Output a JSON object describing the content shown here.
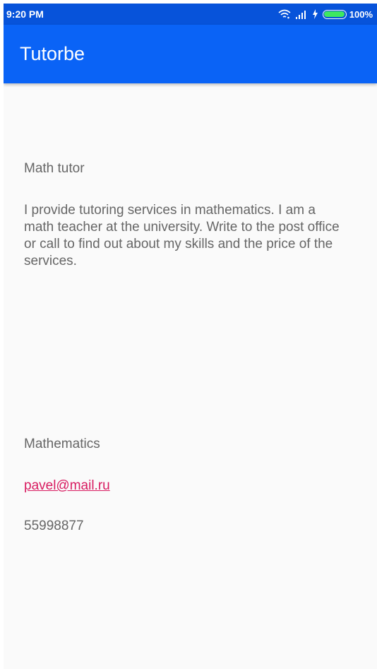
{
  "status_bar": {
    "time": "9:20 PM",
    "battery_percent": "100%",
    "battery_level": 1.0,
    "icons": [
      "wifi-icon",
      "signal-icon",
      "charging-icon",
      "battery-icon"
    ]
  },
  "app_bar": {
    "title": "Tutorbe"
  },
  "tutor": {
    "title": "Math tutor",
    "description": "I provide tutoring services in mathematics. I am a math teacher at the university. Write to the post office or call to find out about my skills and the price of the services.",
    "subject": "Mathematics",
    "email": "pavel@mail.ru",
    "phone": "55998877"
  },
  "colors": {
    "status_bar": "#0753da",
    "app_bar": "#0a63f6",
    "background": "#fafafa",
    "text": "#666666",
    "link": "#d81b60",
    "battery": "#3ee861"
  }
}
